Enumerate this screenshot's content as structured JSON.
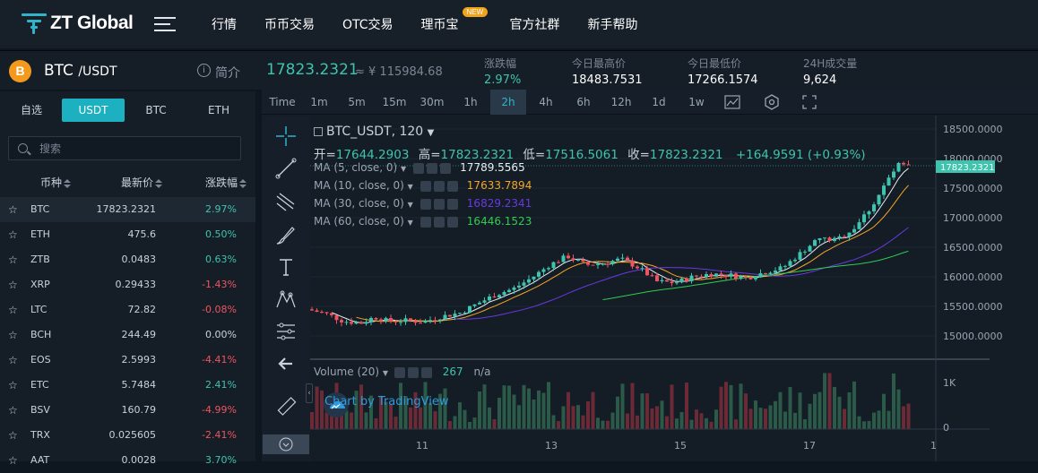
{
  "brand": {
    "name": "ZT Global"
  },
  "nav": {
    "items": [
      "行情",
      "币币交易",
      "OTC交易",
      "理币宝",
      "官方社群",
      "新手帮助"
    ],
    "new_badge": "NEW"
  },
  "ticker": {
    "coin_letter": "B",
    "base": "BTC",
    "quote": "/USDT",
    "intro": "简介",
    "price": "17823.2321",
    "cny": "≈ ¥ 115984.68",
    "stats": [
      {
        "label": "涨跌幅",
        "value": "2.97%"
      },
      {
        "label": "今日最高价",
        "value": "18483.7531"
      },
      {
        "label": "今日最低价",
        "value": "17266.1574"
      },
      {
        "label": "24H成交量",
        "value": "9,624"
      }
    ]
  },
  "market": {
    "tabs": [
      "自选",
      "USDT",
      "BTC",
      "ETH"
    ],
    "active_tab": "USDT",
    "search_placeholder": "搜索",
    "columns": [
      "币种",
      "最新价",
      "涨跌幅"
    ],
    "rows": [
      {
        "symbol": "BTC",
        "price": "17823.2321",
        "change": "2.97%",
        "dir": "up"
      },
      {
        "symbol": "ETH",
        "price": "475.6",
        "change": "0.50%",
        "dir": "up"
      },
      {
        "symbol": "ZTB",
        "price": "0.0483",
        "change": "0.63%",
        "dir": "up"
      },
      {
        "symbol": "XRP",
        "price": "0.29433",
        "change": "-1.43%",
        "dir": "down"
      },
      {
        "symbol": "LTC",
        "price": "72.82",
        "change": "-0.08%",
        "dir": "down"
      },
      {
        "symbol": "BCH",
        "price": "244.49",
        "change": "0.00%",
        "dir": "flat"
      },
      {
        "symbol": "EOS",
        "price": "2.5993",
        "change": "-4.41%",
        "dir": "down"
      },
      {
        "symbol": "ETC",
        "price": "5.7484",
        "change": "2.41%",
        "dir": "up"
      },
      {
        "symbol": "BSV",
        "price": "160.79",
        "change": "-4.99%",
        "dir": "down"
      },
      {
        "symbol": "TRX",
        "price": "0.025605",
        "change": "-2.41%",
        "dir": "down"
      },
      {
        "symbol": "AAT",
        "price": "0.0028",
        "change": "3.70%",
        "dir": "up"
      }
    ]
  },
  "chart": {
    "timeframes": [
      "Time",
      "1m",
      "5m",
      "15m",
      "30m",
      "1h",
      "2h",
      "4h",
      "6h",
      "12h",
      "1d",
      "1w"
    ],
    "active_timeframe": "2h",
    "symbol_title": "BTC_USDT, 120",
    "ohlc": {
      "o_label": "开=",
      "o": "17644.2903",
      "h_label": "高=",
      "h": "17823.2321",
      "l_label": "低=",
      "l": "17516.5061",
      "c_label": "收=",
      "c": "17823.2321",
      "change": "+164.9591 (+0.93%)"
    },
    "ma": [
      {
        "label": "MA (5, close, 0)",
        "value": "17789.5565",
        "color": "#e8edf2"
      },
      {
        "label": "MA (10, close, 0)",
        "value": "17633.7894",
        "color": "#f5a623"
      },
      {
        "label": "MA (30, close, 0)",
        "value": "16829.2341",
        "color": "#6a39e0"
      },
      {
        "label": "MA (60, close, 0)",
        "value": "16446.1523",
        "color": "#2fcd4f"
      }
    ],
    "price_axis": [
      "18500.0000",
      "18000.0000",
      "17500.0000",
      "17000.0000",
      "16500.0000",
      "16000.0000",
      "15500.0000",
      "15000.0000"
    ],
    "last_price_tag": "17823.2321",
    "volume_label": "Volume (20)",
    "volume_value": "267",
    "volume_na": "n/a",
    "volume_axis": [
      "1K",
      "0"
    ],
    "time_axis": [
      "11",
      "13",
      "15",
      "17",
      "1"
    ],
    "watermark": "Chart by TradingView",
    "colors": {
      "up": "#3ec4ae",
      "down": "#f0545e"
    }
  }
}
